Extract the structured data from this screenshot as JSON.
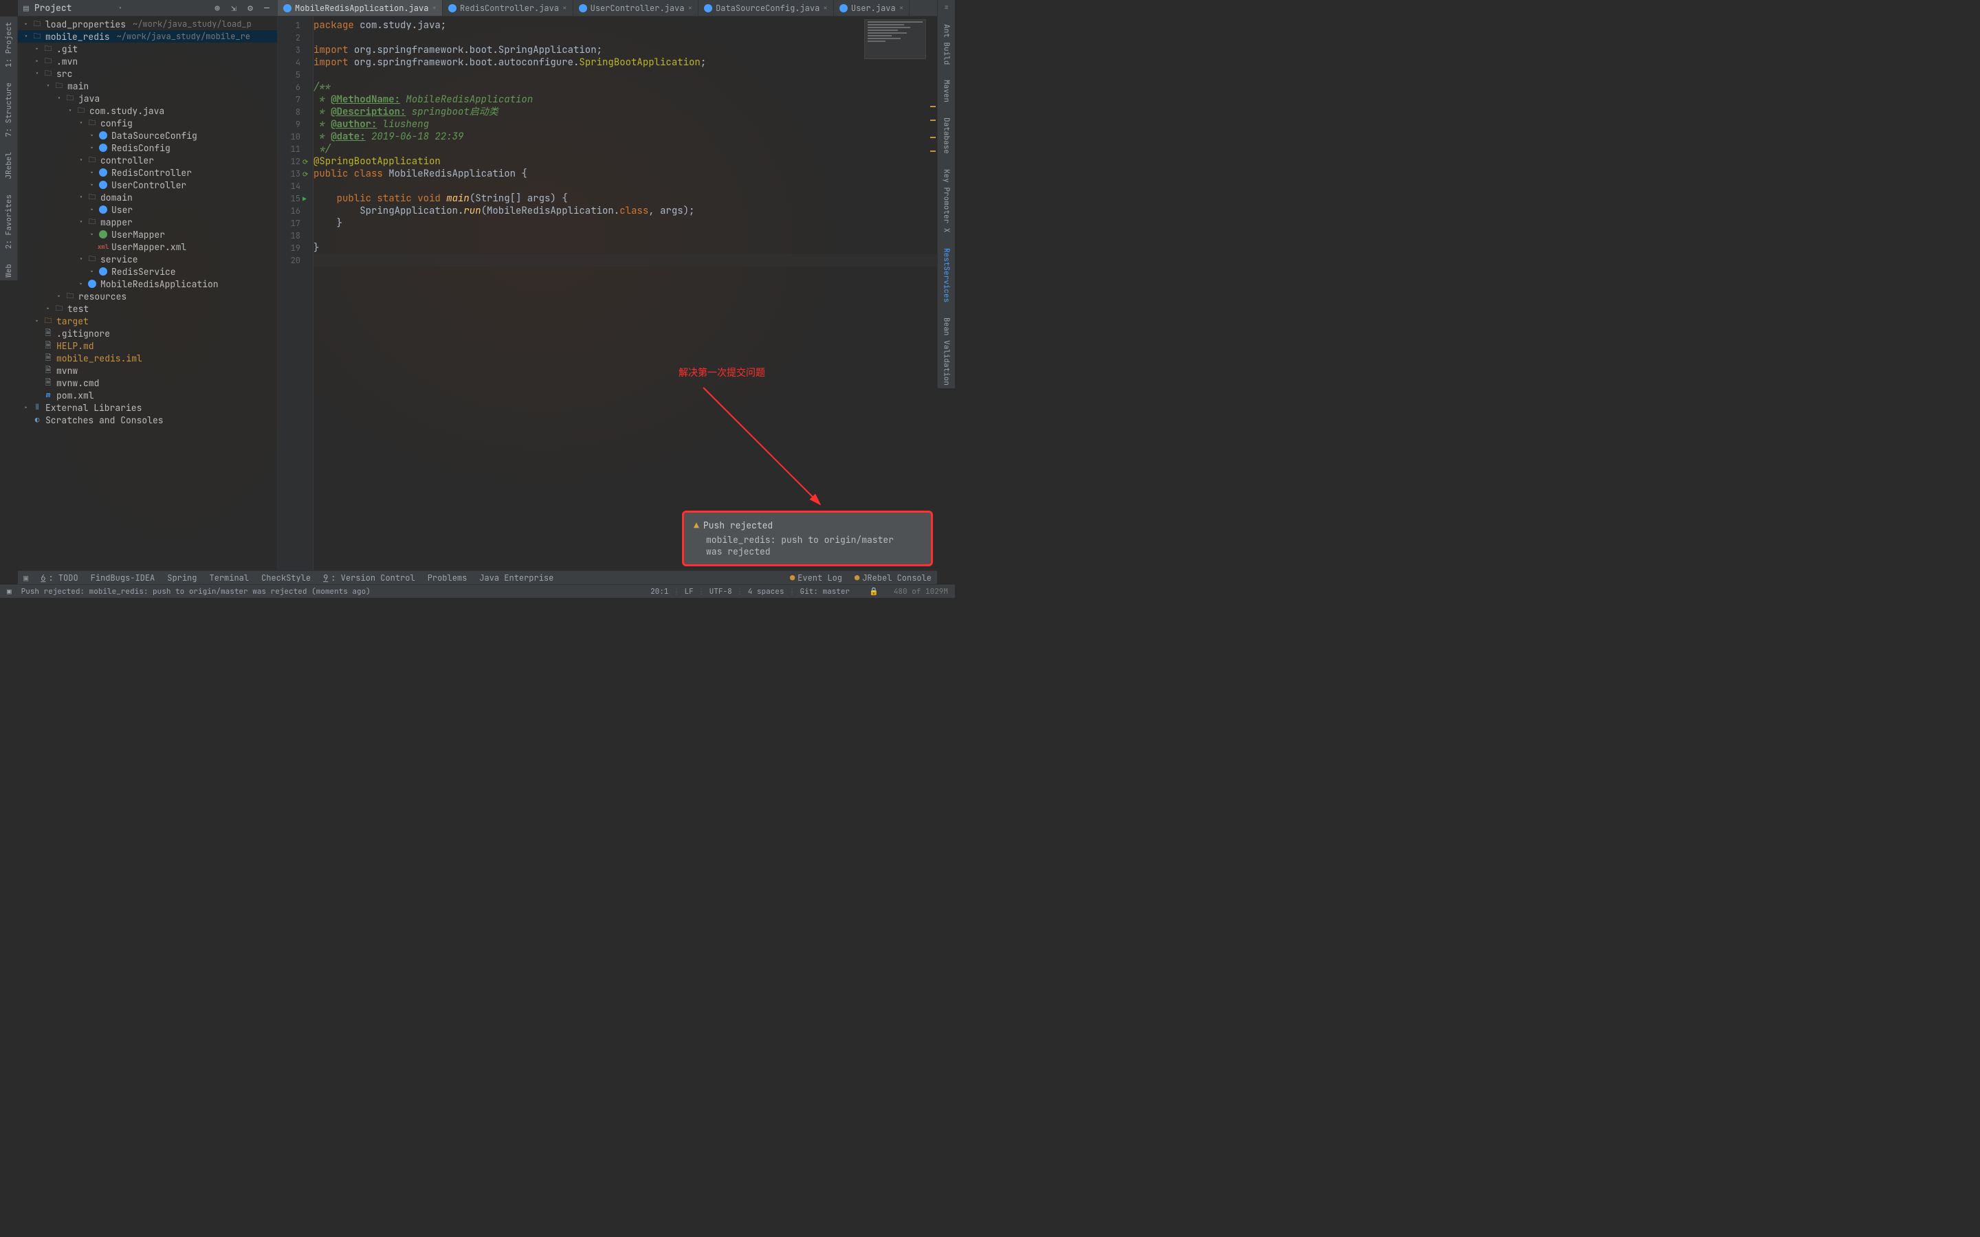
{
  "proj_panel": {
    "title": "Project"
  },
  "left_tools": [
    "1: Project",
    "7: Structure",
    "JRebel",
    "2: Favorites",
    "Web"
  ],
  "right_tools": [
    {
      "label": "Ant Build",
      "cls": ""
    },
    {
      "label": "Maven",
      "cls": ""
    },
    {
      "label": "Database",
      "cls": ""
    },
    {
      "label": "Key Promoter X",
      "cls": ""
    },
    {
      "label": "RestServices",
      "cls": "blue"
    },
    {
      "label": "Bean Validation",
      "cls": ""
    }
  ],
  "tabs": [
    {
      "name": "MobileRedisApplication.java",
      "active": true
    },
    {
      "name": "RedisController.java",
      "active": false
    },
    {
      "name": "UserController.java",
      "active": false
    },
    {
      "name": "DataSourceConfig.java",
      "active": false
    },
    {
      "name": "User.java",
      "active": false
    }
  ],
  "tree": [
    {
      "d": 0,
      "a": "▸",
      "i": "folder",
      "t": "load_properties",
      "hint": "~/work/java_study/load_p"
    },
    {
      "d": 0,
      "a": "▾",
      "i": "folder",
      "t": "mobile_redis",
      "hint": "~/work/java_study/mobile_re",
      "sel": true
    },
    {
      "d": 1,
      "a": "▸",
      "i": "folder",
      "t": ".git"
    },
    {
      "d": 1,
      "a": "▸",
      "i": "folder",
      "t": ".mvn"
    },
    {
      "d": 1,
      "a": "▾",
      "i": "folder",
      "t": "src"
    },
    {
      "d": 2,
      "a": "▾",
      "i": "folder",
      "t": "main"
    },
    {
      "d": 3,
      "a": "▾",
      "i": "folder-src",
      "t": "java"
    },
    {
      "d": 4,
      "a": "▾",
      "i": "pkg",
      "t": "com.study.java"
    },
    {
      "d": 5,
      "a": "▾",
      "i": "pkg",
      "t": "config"
    },
    {
      "d": 6,
      "a": "▸",
      "i": "class",
      "t": "DataSourceConfig"
    },
    {
      "d": 6,
      "a": "▸",
      "i": "class",
      "t": "RedisConfig"
    },
    {
      "d": 5,
      "a": "▾",
      "i": "pkg",
      "t": "controller"
    },
    {
      "d": 6,
      "a": "▸",
      "i": "class",
      "t": "RedisController"
    },
    {
      "d": 6,
      "a": "▸",
      "i": "class",
      "t": "UserController"
    },
    {
      "d": 5,
      "a": "▾",
      "i": "pkg",
      "t": "domain"
    },
    {
      "d": 6,
      "a": "▸",
      "i": "class",
      "t": "User"
    },
    {
      "d": 5,
      "a": "▾",
      "i": "pkg",
      "t": "mapper"
    },
    {
      "d": 6,
      "a": "▸",
      "i": "int",
      "t": "UserMapper"
    },
    {
      "d": 6,
      "a": "",
      "i": "xml",
      "t": "UserMapper.xml"
    },
    {
      "d": 5,
      "a": "▾",
      "i": "pkg",
      "t": "service"
    },
    {
      "d": 6,
      "a": "▸",
      "i": "class",
      "t": "RedisService"
    },
    {
      "d": 5,
      "a": "▸",
      "i": "class",
      "t": "MobileRedisApplication"
    },
    {
      "d": 3,
      "a": "▸",
      "i": "folder-res",
      "t": "resources"
    },
    {
      "d": 2,
      "a": "▸",
      "i": "folder",
      "t": "test"
    },
    {
      "d": 1,
      "a": "▸",
      "i": "folder-o",
      "t": "target",
      "orange": true
    },
    {
      "d": 1,
      "a": "",
      "i": "file",
      "t": ".gitignore"
    },
    {
      "d": 1,
      "a": "",
      "i": "file",
      "t": "HELP.md",
      "orange": true
    },
    {
      "d": 1,
      "a": "",
      "i": "file",
      "t": "mobile_redis.iml",
      "orange": true
    },
    {
      "d": 1,
      "a": "",
      "i": "file",
      "t": "mvnw"
    },
    {
      "d": 1,
      "a": "",
      "i": "file",
      "t": "mvnw.cmd"
    },
    {
      "d": 1,
      "a": "",
      "i": "mvn",
      "t": "pom.xml"
    },
    {
      "d": 0,
      "a": "▸",
      "i": "lib",
      "t": "External Libraries"
    },
    {
      "d": 0,
      "a": "",
      "i": "scratch",
      "t": "Scratches and Consoles"
    }
  ],
  "code_lines": [
    [
      {
        "t": "package ",
        "c": "kw"
      },
      {
        "t": "com.study.java;",
        "c": ""
      }
    ],
    [],
    [
      {
        "t": "import ",
        "c": "kw"
      },
      {
        "t": "org.springframework.boot.SpringApplication;",
        "c": ""
      }
    ],
    [
      {
        "t": "import ",
        "c": "kw"
      },
      {
        "t": "org.springframework.boot.autoconfigure.",
        "c": ""
      },
      {
        "t": "SpringBootApplication",
        "c": "ann"
      },
      {
        "t": ";",
        "c": ""
      }
    ],
    [],
    [
      {
        "t": "/**",
        "c": "doc"
      }
    ],
    [
      {
        "t": " * ",
        "c": "doc"
      },
      {
        "t": "@MethodName:",
        "c": "doctag"
      },
      {
        "t": " MobileRedisApplication",
        "c": "doc"
      }
    ],
    [
      {
        "t": " * ",
        "c": "doc"
      },
      {
        "t": "@Description:",
        "c": "doctag"
      },
      {
        "t": " springboot启动类",
        "c": "doc"
      }
    ],
    [
      {
        "t": " * ",
        "c": "doc"
      },
      {
        "t": "@author:",
        "c": "doctag"
      },
      {
        "t": " liusheng",
        "c": "doc"
      }
    ],
    [
      {
        "t": " * ",
        "c": "doc"
      },
      {
        "t": "@date:",
        "c": "doctag"
      },
      {
        "t": " 2019-06-18 22:39",
        "c": "doc"
      }
    ],
    [
      {
        "t": " */",
        "c": "doc"
      }
    ],
    [
      {
        "t": "@SpringBootApplication",
        "c": "ann"
      }
    ],
    [
      {
        "t": "public class ",
        "c": "kw"
      },
      {
        "t": "MobileRedisApplication {",
        "c": ""
      }
    ],
    [],
    [
      {
        "t": "    public static void ",
        "c": "kw"
      },
      {
        "t": "main",
        "c": "fn"
      },
      {
        "t": "(String[] args) {",
        "c": ""
      }
    ],
    [
      {
        "t": "        SpringApplication.",
        "c": ""
      },
      {
        "t": "run",
        "c": "fn"
      },
      {
        "t": "(MobileRedisApplication.",
        "c": ""
      },
      {
        "t": "class",
        "c": "kw"
      },
      {
        "t": ", args);",
        "c": ""
      }
    ],
    [
      {
        "t": "    }",
        "c": ""
      }
    ],
    [],
    [
      {
        "t": "}",
        "c": ""
      }
    ],
    []
  ],
  "annotation": "解决第一次提交问题",
  "notification": {
    "title": "Push rejected",
    "body1": "mobile_redis: push to origin/master",
    "body2": "was rejected"
  },
  "bottom_tools": [
    {
      "t": "6: TODO",
      "u": true
    },
    {
      "t": "FindBugs-IDEA"
    },
    {
      "t": "Spring"
    },
    {
      "t": "Terminal"
    },
    {
      "t": "CheckStyle"
    },
    {
      "t": "9: Version Control",
      "u": true
    },
    {
      "t": "Problems"
    },
    {
      "t": "Java Enterprise"
    }
  ],
  "bottom_right": [
    {
      "t": "Event Log"
    },
    {
      "t": "JRebel Console"
    }
  ],
  "status_left": "Push rejected: mobile_redis: push to origin/master was rejected (moments ago)",
  "status_right": [
    "20:1",
    "LF",
    "UTF-8",
    "4 spaces",
    "Git: master"
  ],
  "watermark": "480 of 1029M"
}
